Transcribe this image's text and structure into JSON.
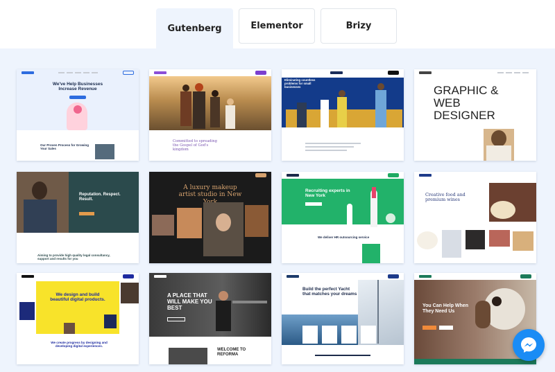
{
  "tabs": [
    {
      "label": "Gutenberg",
      "active": true
    },
    {
      "label": "Elementor",
      "active": false
    },
    {
      "label": "Brizy",
      "active": false
    }
  ],
  "templates": [
    {
      "headline": "We've Help Businesses Increase Revenue",
      "subhead": "Our Proven Process for Growing Your Sales"
    },
    {
      "headline": "Committed to spreading the Gospel of God's kingdom"
    },
    {
      "headline": "Eliminating countless problems for small businesses"
    },
    {
      "headline": "GRAPHIC & WEB DESIGNER"
    },
    {
      "headline": "Reputation. Respect. Result.",
      "subhead": "Aiming to provide high quality legal consultancy, support and results for you"
    },
    {
      "headline": "A luxury makeup artist studio in New York"
    },
    {
      "headline": "Recruiting experts in New York",
      "subhead": "We deliver HR outsourcing service"
    },
    {
      "headline": "Creative food and premium wines"
    },
    {
      "headline": "We design and build beautiful digital products.",
      "subhead": "We create progress by designing and developing digital experiences."
    },
    {
      "headline": "A PLACE THAT WILL MAKE YOU BEST",
      "subhead": "WELCOME TO REFORMA"
    },
    {
      "headline": "Build the perfect Yacht that matches your dreams"
    },
    {
      "headline": "You Can Help When They Need Us"
    }
  ],
  "colors": {
    "accent": "#1a8cf5",
    "gallery_bg": "#eef4fd"
  },
  "icons": {
    "chat": "messenger-icon"
  }
}
